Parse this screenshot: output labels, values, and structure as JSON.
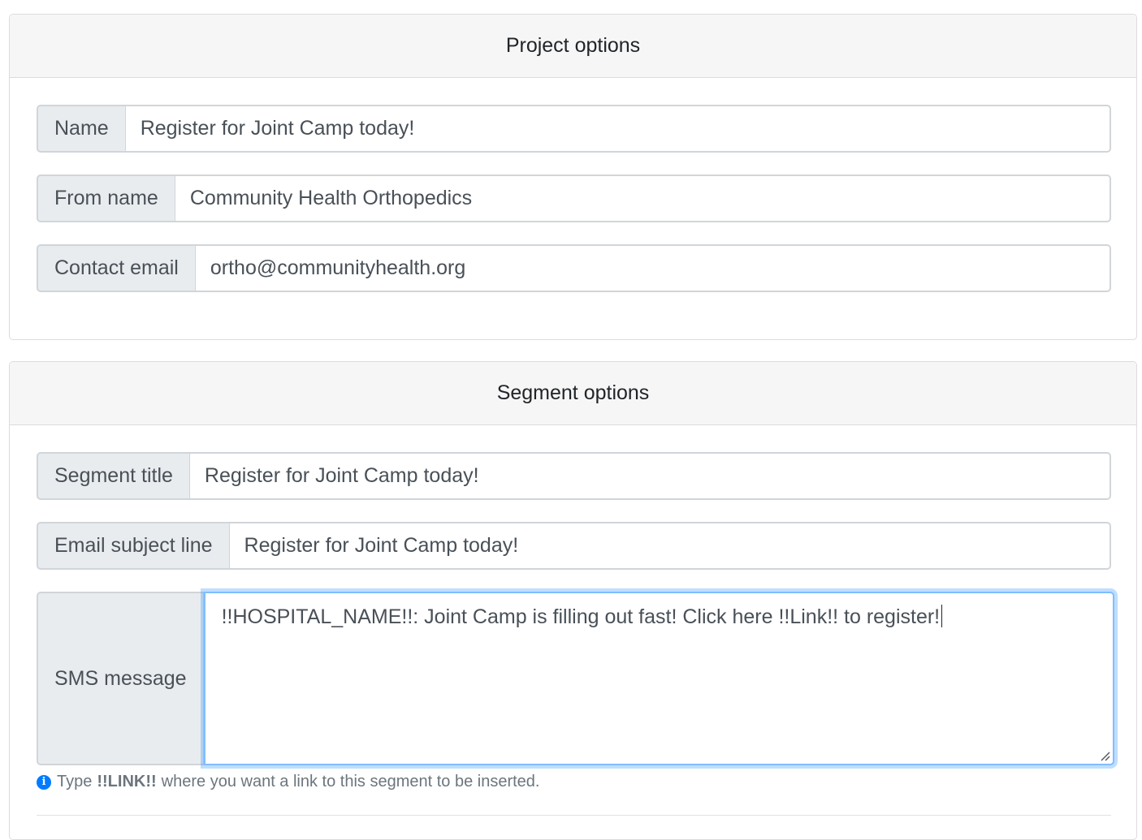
{
  "project_options": {
    "title": "Project options",
    "name_label": "Name",
    "name_value": "Register for Joint Camp today!",
    "from_name_label": "From name",
    "from_name_value": "Community Health Orthopedics",
    "contact_email_label": "Contact email",
    "contact_email_value": "ortho@communityhealth.org"
  },
  "segment_options": {
    "title": "Segment options",
    "segment_title_label": "Segment title",
    "segment_title_value": "Register for Joint Camp today!",
    "email_subject_label": "Email subject line",
    "email_subject_value": "Register for Joint Camp today!",
    "sms_label": "SMS message",
    "sms_value": "!!HOSPITAL_NAME!!: Joint Camp is filling out fast! Click here !!Link!! to register!",
    "help_prefix": "Type",
    "help_keyword": "!!LINK!!",
    "help_suffix": "where you want a link to this segment to be inserted."
  },
  "icons": {
    "info": "info-circle-icon",
    "resize": "resize-handle-icon"
  },
  "colors": {
    "focus_border": "#80bdff",
    "info_icon": "#007bff",
    "addon_bg": "#e9ecef",
    "header_bg": "#f6f6f6"
  }
}
